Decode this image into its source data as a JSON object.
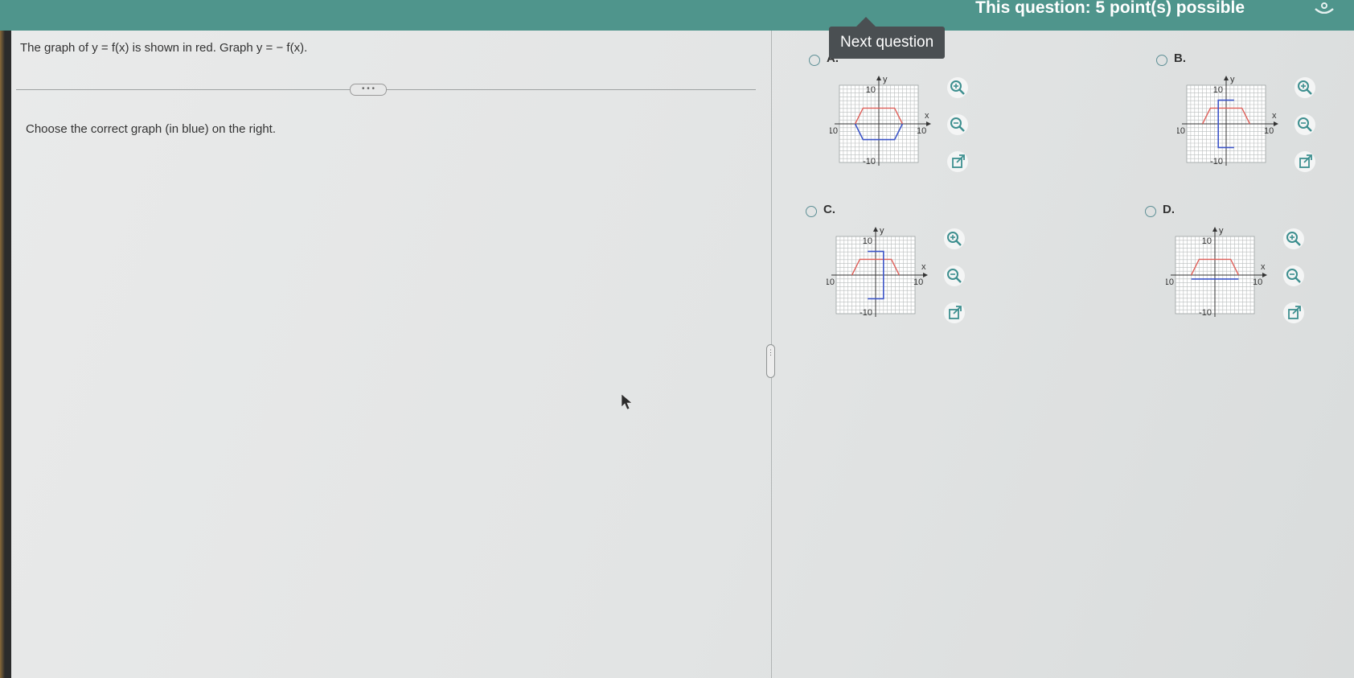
{
  "header": {
    "points_text": "This question: 5 point(s) possible"
  },
  "question": {
    "prompt": "The graph of y = f(x) is shown in red. Graph y = − f(x).",
    "more_label": "• • •",
    "instruction": "Choose the correct graph (in blue) on the right."
  },
  "tooltip": {
    "text": "Next question"
  },
  "options": [
    {
      "label": "A."
    },
    {
      "label": "B."
    },
    {
      "label": "C."
    },
    {
      "label": "D."
    }
  ],
  "graph_labels": {
    "y": "y",
    "x": "x",
    "ymax": "10",
    "xmin": "-10",
    "xmax": "10",
    "ymin": "-10"
  },
  "colors": {
    "header": "#4f958c",
    "red_curve": "#e0605a",
    "blue_curve": "#3d55c8",
    "accent": "#3d8f8f"
  },
  "icons": [
    "zoom-in-icon",
    "zoom-out-icon",
    "new-window-icon",
    "gear-icon"
  ]
}
